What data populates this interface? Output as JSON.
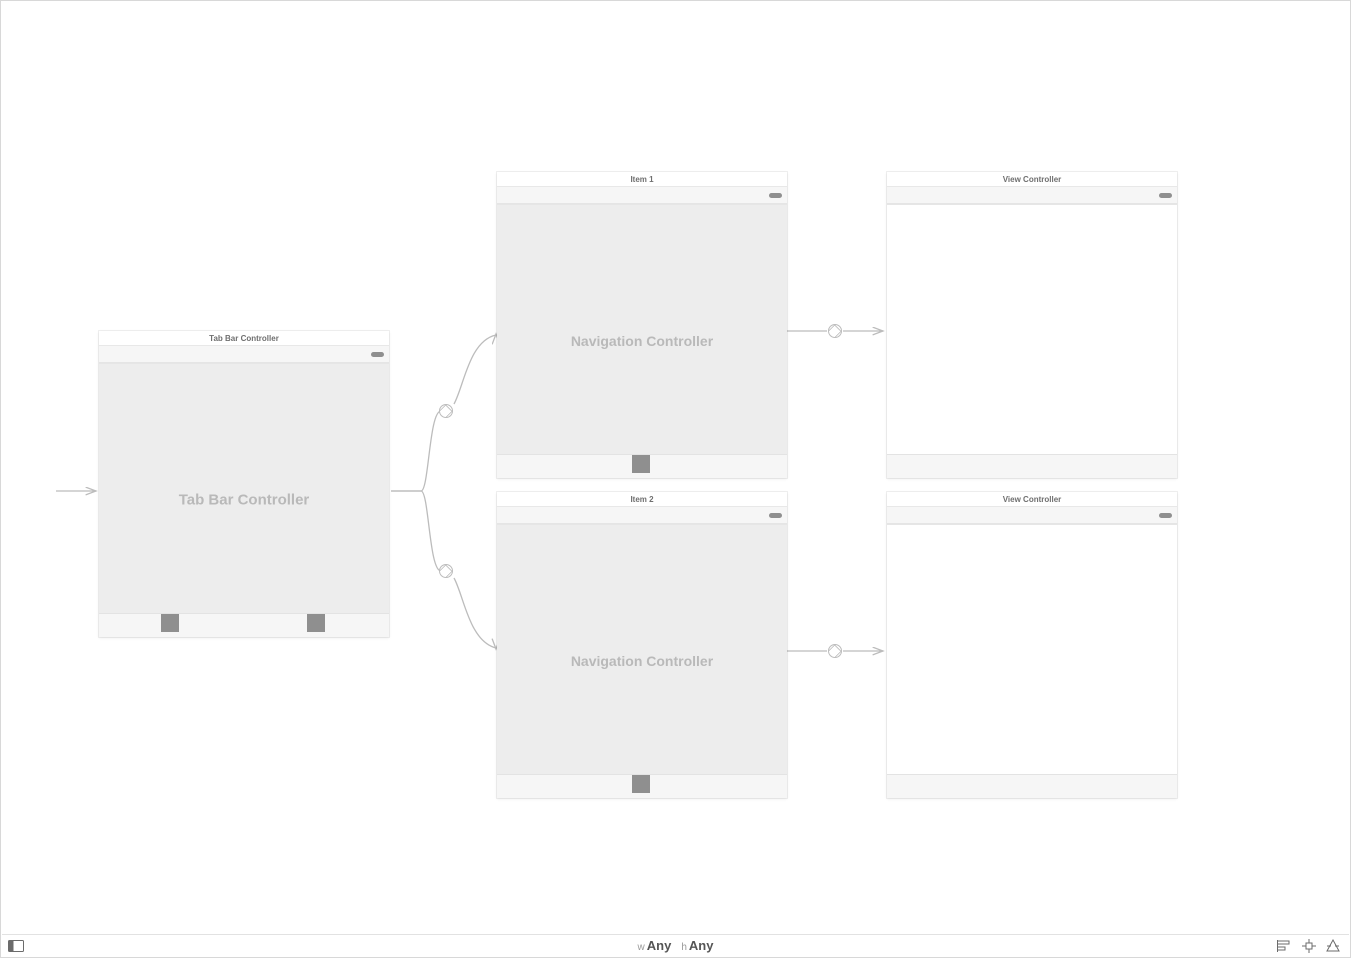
{
  "scenes": {
    "tabbar": {
      "title": "Tab Bar Controller",
      "body_label": "Tab Bar Controller"
    },
    "nav1": {
      "title": "Item 1",
      "body_label": "Navigation Controller"
    },
    "nav2": {
      "title": "Item 2",
      "body_label": "Navigation Controller"
    },
    "vc1": {
      "title": "View Controller"
    },
    "vc2": {
      "title": "View Controller"
    }
  },
  "bottombar": {
    "size_w_prefix": "w",
    "size_w": "Any",
    "size_h_prefix": "h",
    "size_h": "Any"
  }
}
